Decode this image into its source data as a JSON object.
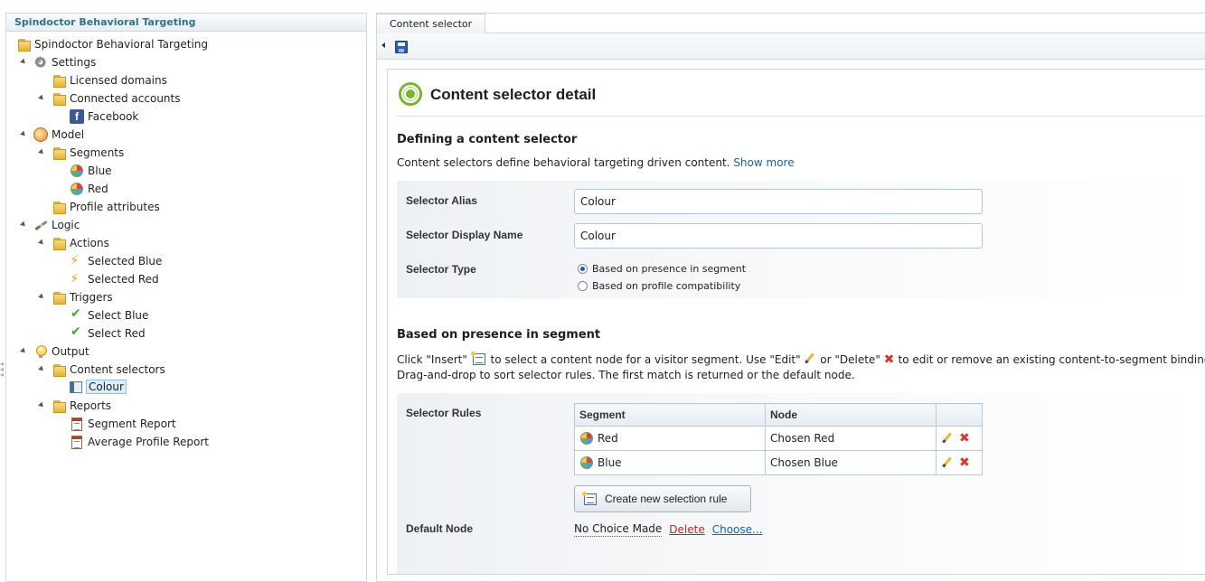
{
  "tree": {
    "header": "Spindoctor Behavioral Targeting",
    "nodes": [
      {
        "label": "Spindoctor Behavioral Targeting"
      },
      {
        "label": "Settings"
      },
      {
        "label": "Licensed domains"
      },
      {
        "label": "Connected accounts"
      },
      {
        "label": "Facebook"
      },
      {
        "label": "Model"
      },
      {
        "label": "Segments"
      },
      {
        "label": "Blue"
      },
      {
        "label": "Red"
      },
      {
        "label": "Profile attributes"
      },
      {
        "label": "Logic"
      },
      {
        "label": "Actions"
      },
      {
        "label": "Selected Blue"
      },
      {
        "label": "Selected Red"
      },
      {
        "label": "Triggers"
      },
      {
        "label": "Select Blue"
      },
      {
        "label": "Select Red"
      },
      {
        "label": "Output"
      },
      {
        "label": "Content selectors"
      },
      {
        "label": "Colour"
      },
      {
        "label": "Reports"
      },
      {
        "label": "Segment Report"
      },
      {
        "label": "Average Profile Report"
      }
    ],
    "selected": "Colour"
  },
  "tabs": [
    {
      "label": "Content selector"
    }
  ],
  "detail": {
    "title": "Content selector detail",
    "section1": {
      "title": "Defining a content selector",
      "description": "Content selectors define behavioral targeting driven content.",
      "show_more": "Show more"
    },
    "form": {
      "alias_label": "Selector Alias",
      "alias_value": "Colour",
      "display_name_label": "Selector Display Name",
      "display_name_value": "Colour",
      "type_label": "Selector Type",
      "type_options": [
        "Based on presence in segment",
        "Based on profile compatibility"
      ],
      "type_selected": "Based on presence in segment"
    },
    "section2": {
      "title": "Based on presence in segment",
      "help_part1": "Click \"Insert\"",
      "help_part2": "to select a content node for a visitor segment. Use \"Edit\"",
      "help_part3": "or \"Delete\"",
      "help_part4": "to edit or remove an existing content-to-segment binding.",
      "help_line2": "Drag-and-drop to sort selector rules. The first match is returned or the default node."
    },
    "rules": {
      "label": "Selector Rules",
      "columns": [
        "Segment",
        "Node",
        ""
      ],
      "rows": [
        {
          "segment": "Red",
          "node": "Chosen Red"
        },
        {
          "segment": "Blue",
          "node": "Chosen Blue"
        }
      ],
      "create_button": "Create new selection rule"
    },
    "default_node": {
      "label": "Default Node",
      "value": "No Choice Made",
      "delete": "Delete",
      "choose": "Choose..."
    }
  },
  "colors": {
    "tree_header_text": "#2f7388",
    "link_blue": "#1b5fb0",
    "delete_red": "#cc1f1f",
    "accent_green": "#76b82a"
  }
}
